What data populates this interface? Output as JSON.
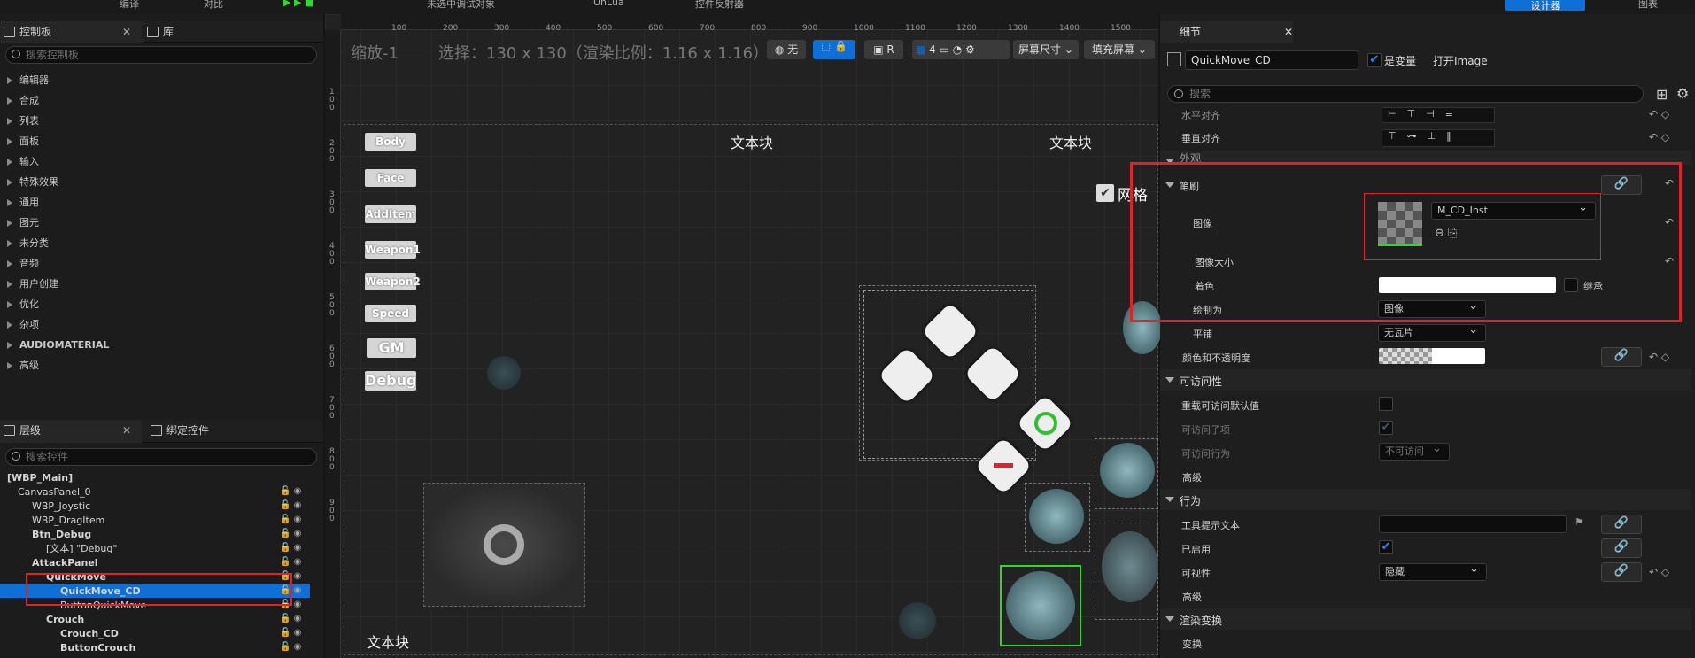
{
  "topbar": {
    "compile": "编译",
    "diff": "对比",
    "debug_target": "未选中调试对象",
    "unlua": "UnLua",
    "binding": "控件反射器",
    "designer": "设计器",
    "graph": "图表"
  },
  "left": {
    "palette_tab": "控制板",
    "library_tab": "库",
    "palette_search": "搜索控制板",
    "categories": [
      "编辑器",
      "合成",
      "列表",
      "面板",
      "输入",
      "特殊效果",
      "通用",
      "图元",
      "未分类",
      "音频",
      "用户创建",
      "优化",
      "杂项",
      "AUDIOMATERIAL",
      "高级"
    ],
    "hierarchy_tab": "层级",
    "bind_tab": "绑定控件",
    "hierarchy_search": "搜索控件",
    "tree": [
      "[WBP_Main]",
      "CanvasPanel_0",
      "WBP_Joystic",
      "WBP_DragItem",
      "Btn_Debug",
      "[文本] \"Debug\"",
      "AttackPanel",
      "QuickMove",
      "QuickMove_CD",
      "ButtonQuickMove",
      "Crouch",
      "Crouch_CD",
      "ButtonCrouch"
    ]
  },
  "viewport": {
    "zoom": "缩放-1",
    "selection": "选择：130 x 130（渲染比例：1.16 x 1.16）",
    "none_label": "无",
    "r_label": "R",
    "grid_num": "4",
    "screen_size": "屏幕尺寸",
    "fill_screen": "填充屏幕",
    "ruler_ticks": [
      "100",
      "200",
      "300",
      "400",
      "500",
      "600",
      "700",
      "800",
      "900",
      "1000",
      "1100",
      "1200",
      "1300",
      "1400",
      "1500"
    ],
    "vruler_ticks": [
      "100",
      "200",
      "300",
      "400",
      "500",
      "600",
      "700",
      "800",
      "900"
    ],
    "buttons": [
      "Body",
      "Face",
      "AddItem",
      "Weapon1",
      "Weapon2",
      "Speed",
      "GM",
      "Debug"
    ],
    "textblock": "文本块",
    "grid_label": "网格"
  },
  "details": {
    "tab": "细节",
    "widget_name": "QuickMove_CD",
    "is_variable": "是变量",
    "open_image": "打开Image",
    "search": "搜索",
    "h_align": "水平对齐",
    "v_align": "垂直对齐",
    "appearance": "外观",
    "brush": "笔刷",
    "image": "图像",
    "image_value": "M_CD_Inst",
    "image_size": "图像大小",
    "tint": "着色",
    "inherit": "继承",
    "draw_as": "绘制为",
    "draw_as_value": "图像",
    "tiling": "平铺",
    "tiling_value": "无瓦片",
    "color_opacity": "颜色和不透明度",
    "accessibility": "可访问性",
    "override_access": "重载可访问默认值",
    "access_children": "可访问子项",
    "access_behavior": "可访问行为",
    "access_behavior_value": "不可访问",
    "advanced": "高级",
    "behavior": "行为",
    "tooltip": "工具提示文本",
    "enabled": "已启用",
    "visibility": "可视性",
    "visibility_value": "隐藏",
    "advanced2": "高级",
    "render_transform": "渲染变换",
    "transform": "变换"
  },
  "colors": {
    "accent": "#0e6fd6",
    "highlight": "#e0222a",
    "selection_green": "#2fd82f"
  }
}
